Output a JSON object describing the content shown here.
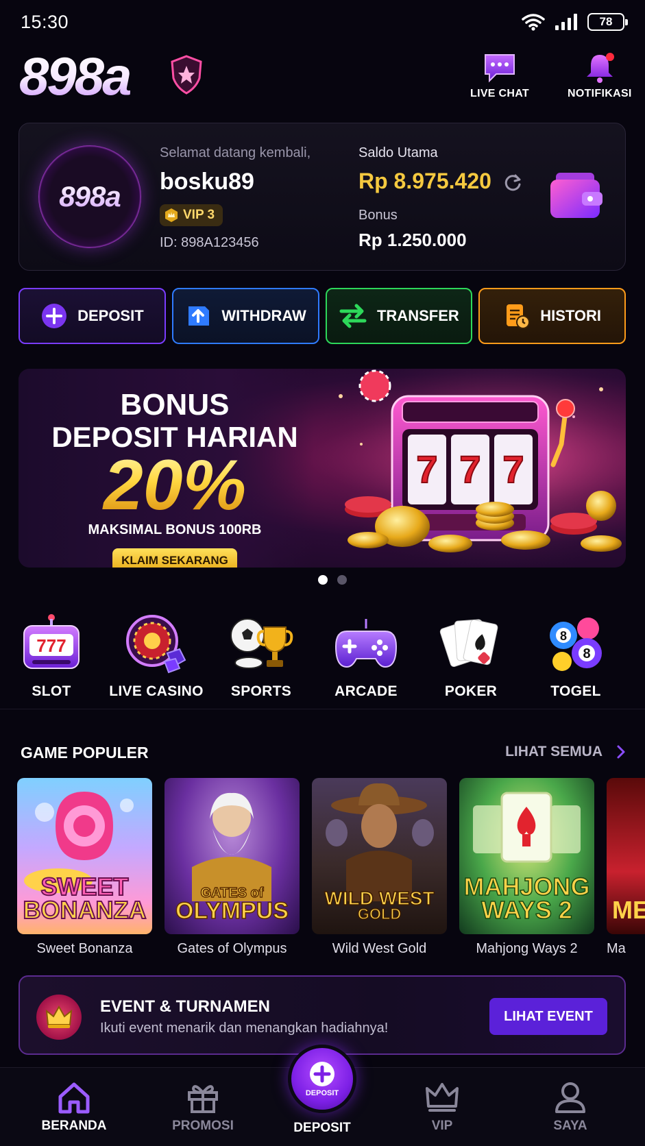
{
  "status": {
    "time": "15:30",
    "battery": "78"
  },
  "header": {
    "brand": "898a",
    "live_chat_label": "LIVE CHAT",
    "notif_label": "NOTIFIKASI"
  },
  "account": {
    "avatar_text": "898a",
    "welcome": "Selamat datang kembali,",
    "username": "bosku89",
    "vip": "VIP 3",
    "user_id": "ID: 898A123456",
    "saldo_label": "Saldo Utama",
    "saldo_value": "Rp 8.975.420",
    "bonus_label": "Bonus",
    "bonus_value": "Rp 1.250.000"
  },
  "actions": {
    "deposit": "DEPOSIT",
    "withdraw": "WITHDRAW",
    "transfer": "TRANSFER",
    "histori": "HISTORI"
  },
  "banner": {
    "title1": "BONUS",
    "title2": "DEPOSIT HARIAN",
    "percent": "20%",
    "subtitle": "MAKSIMAL BONUS 100RB",
    "cta": "KLAIM SEKARANG",
    "slides": 2,
    "active_slide": 1
  },
  "categories": [
    "SLOT",
    "LIVE CASINO",
    "SPORTS",
    "ARCADE",
    "POKER",
    "TOGEL"
  ],
  "popular": {
    "title": "GAME POPULER",
    "see_all": "LIHAT SEMUA",
    "games": [
      {
        "name": "Sweet Bonanza",
        "logo1": "SWEET",
        "logo2": "BONANZA"
      },
      {
        "name": "Gates of Olympus",
        "logo1": "GATES of",
        "logo2": "OLYMPUS"
      },
      {
        "name": "Wild West Gold",
        "logo1": "WILD WEST",
        "logo2": "GOLD"
      },
      {
        "name": "Mahjong Ways 2",
        "logo1": "MAHJONG",
        "logo2": "WAYS 2"
      },
      {
        "name": "Ma",
        "logo1": "ME",
        "logo2": ""
      }
    ]
  },
  "event": {
    "title": "EVENT & TURNAMEN",
    "subtitle": "Ikuti event menarik dan menangkan hadiahnya!",
    "button": "LIHAT EVENT"
  },
  "nav": {
    "home": "BERANDA",
    "promo": "PROMOSI",
    "deposit": "DEPOSIT",
    "deposit_small": "DEPOSIT",
    "vip": "VIP",
    "profile": "SAYA"
  },
  "colors": {
    "gold": "#f5c93f",
    "accent": "#7a3cff",
    "bg": "#07050f"
  }
}
